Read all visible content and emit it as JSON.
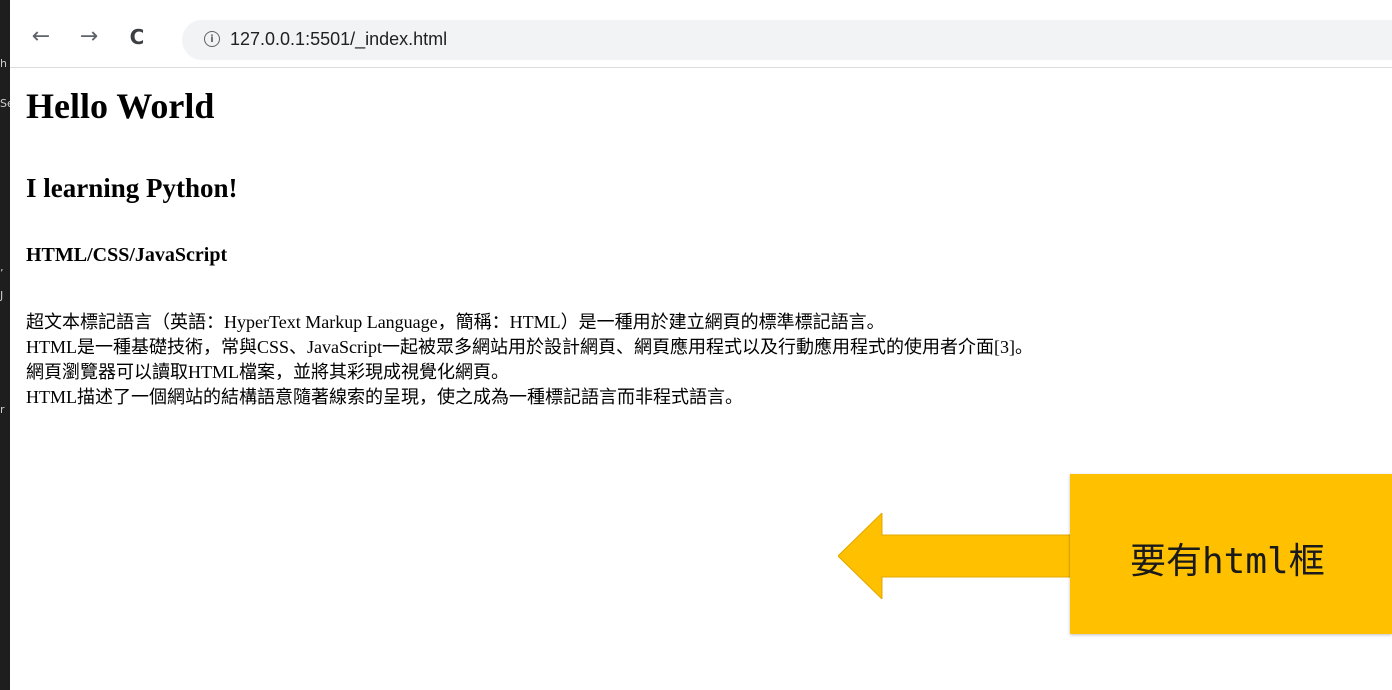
{
  "browser": {
    "back_glyph": "←",
    "forward_glyph": "→",
    "reload_glyph": "C",
    "info_glyph": "i",
    "url": "127.0.0.1:5501/_index.html"
  },
  "left_panel": {
    "glyphs": [
      "h",
      "Se",
      "’",
      "J",
      "r"
    ]
  },
  "page": {
    "h1": "Hello World",
    "h2": "I learning Python!",
    "h3": "HTML/CSS/JavaScript",
    "paragraph_lines": [
      "超文本標記語言（英語：HyperText Markup Language，簡稱：HTML）是一種用於建立網頁的標準標記語言。",
      "HTML是一種基礎技術，常與CSS、JavaScript一起被眾多網站用於設計網頁、網頁應用程式以及行動應用程式的使用者介面[3]。",
      "網頁瀏覽器可以讀取HTML檔案，並將其彩現成視覺化網頁。",
      "HTML描述了一個網站的結構語意隨著線索的呈現，使之成為一種標記語言而非程式語言。"
    ]
  },
  "annotation": {
    "callout_text": "要有html框",
    "color": "#ffc000",
    "arrow_direction": "left"
  }
}
